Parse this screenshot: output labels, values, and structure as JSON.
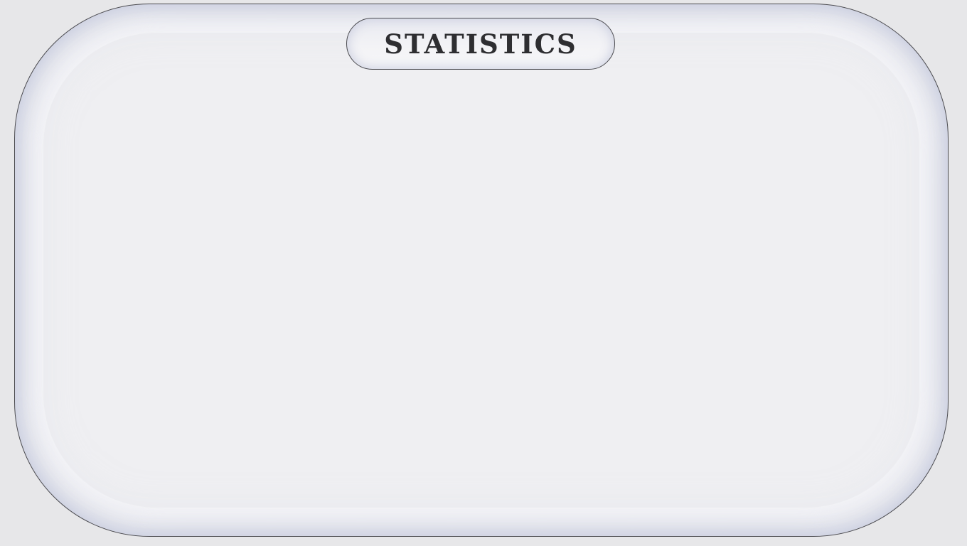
{
  "screen": {
    "title": "STATISTICS"
  },
  "colors": {
    "background": "#e7e7e9",
    "panel_fill": "#efeff2",
    "panel_border": "#4a4a4f",
    "panel_inner_glow": "#c8ccde",
    "title_text": "#2e2e31"
  }
}
